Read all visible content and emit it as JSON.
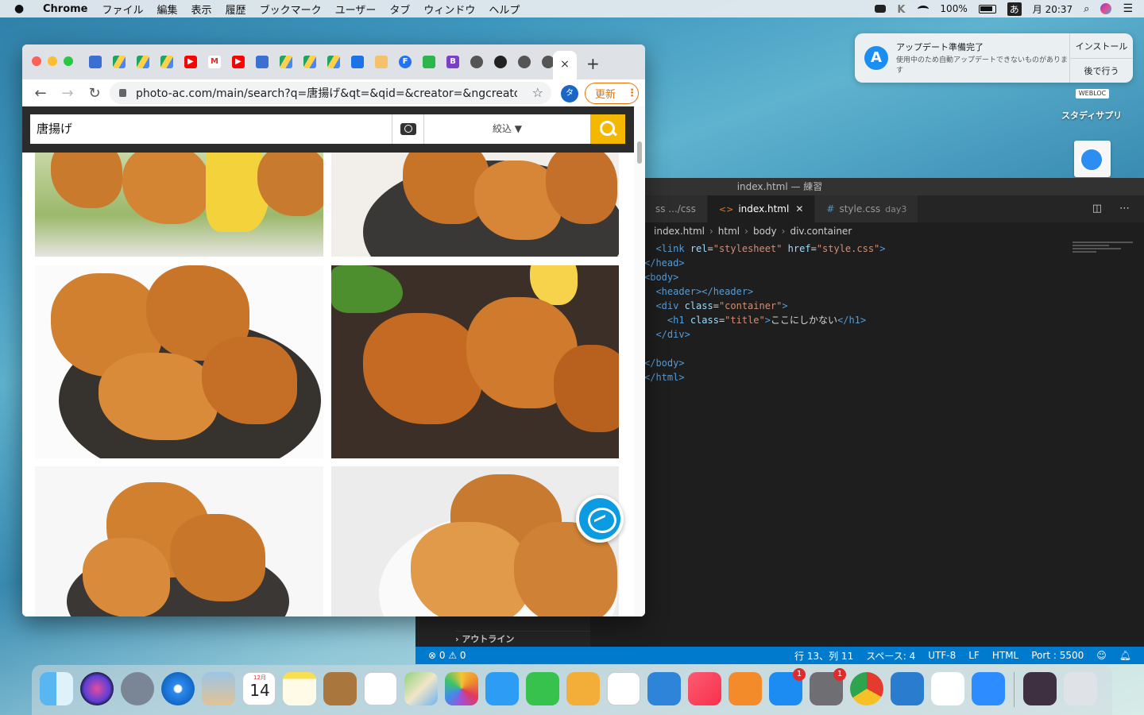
{
  "menubar": {
    "app_name": "Chrome",
    "items": [
      "ファイル",
      "編集",
      "表示",
      "履歴",
      "ブックマーク",
      "ユーザー",
      "タブ",
      "ウィンドウ",
      "ヘルプ"
    ],
    "battery": "100%",
    "input_mode": "あ",
    "clock": "月 20:37"
  },
  "notification": {
    "title": "アップデート準備完了",
    "body": "使用中のため自動アップデートできないものがあります",
    "install_label": "インストール",
    "later_label": "後で行う"
  },
  "desktop": {
    "webloc_tag": "WEBLOC",
    "studysapuri_label": "スタディサプリ"
  },
  "chrome": {
    "url": "photo-ac.com/main/search?q=唐揚げ&qt=&qid=&creator=&ngcreator=&...",
    "profile_initial": "タ",
    "update_label": "更新",
    "tab_close": "×",
    "new_tab": "+",
    "search_query": "唐揚げ",
    "filter_label": "絞込 ▼"
  },
  "vscode": {
    "window_title": "index.html — 練習",
    "tabs": [
      {
        "label": "ss .../css",
        "active": false
      },
      {
        "label": "index.html",
        "active": true
      },
      {
        "label": "style.css",
        "sub": "day3",
        "active": false
      }
    ],
    "breadcrumb": [
      "index.html",
      "html",
      "body",
      "div.container"
    ],
    "code_lines": [
      "<link rel=\"stylesheet\" href=\"style.css\">",
      "</head>",
      "<body>",
      "<header></header>",
      "<div class=\"container\">",
      "<h1 class=\"title\">ここにしかない</h1>",
      "</div>",
      "",
      "</body>",
      "</html>"
    ],
    "outline_label": "アウトライン",
    "status": {
      "errors": "0",
      "warnings": "0",
      "position": "行 13、列 11",
      "spaces": "スペース: 4",
      "encoding": "UTF-8",
      "eol": "LF",
      "language": "HTML",
      "port": "Port : 5500"
    }
  },
  "dock": {
    "calendar_month": "12月",
    "calendar_day": "14",
    "appstore_badge": "1",
    "settings_badge": "1"
  },
  "colors": {
    "vscode_status": "#007acc",
    "photo_ac_accent": "#f5b800",
    "chrome_update": "#e37400"
  }
}
